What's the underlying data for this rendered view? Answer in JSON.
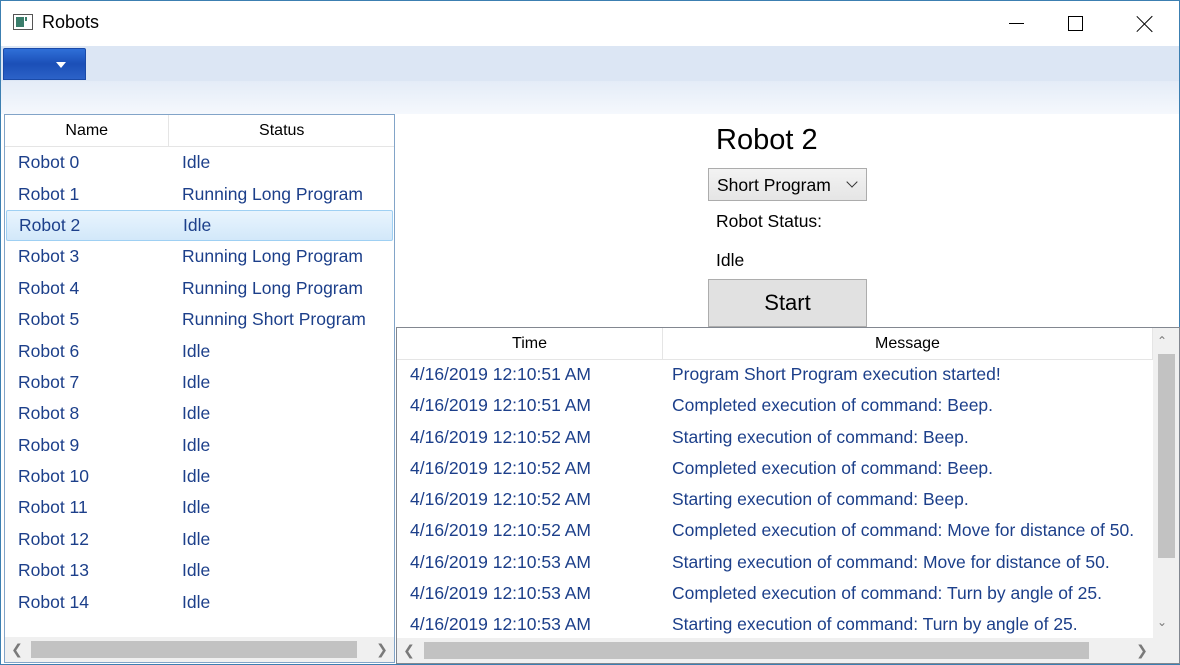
{
  "window": {
    "title": "Robots"
  },
  "titlebar": {
    "icon": "app-window-icon",
    "minimize_icon": "minimize-icon",
    "maximize_icon": "maximize-icon",
    "close_icon": "close-icon"
  },
  "menubar": {
    "app_menu_icon": "chevron-down-icon",
    "accent": "#2f6fd8",
    "background": "#dce6f4"
  },
  "robot_list": {
    "columns": [
      "Name",
      "Status"
    ],
    "selected_index": 2,
    "rows": [
      {
        "name": "Robot 0",
        "status": "Idle"
      },
      {
        "name": "Robot 1",
        "status": "Running Long Program"
      },
      {
        "name": "Robot 2",
        "status": "Idle"
      },
      {
        "name": "Robot 3",
        "status": "Running Long Program"
      },
      {
        "name": "Robot 4",
        "status": "Running Long Program"
      },
      {
        "name": "Robot 5",
        "status": "Running Short Program"
      },
      {
        "name": "Robot 6",
        "status": "Idle"
      },
      {
        "name": "Robot 7",
        "status": "Idle"
      },
      {
        "name": "Robot 8",
        "status": "Idle"
      },
      {
        "name": "Robot 9",
        "status": "Idle"
      },
      {
        "name": "Robot 10",
        "status": "Idle"
      },
      {
        "name": "Robot 11",
        "status": "Idle"
      },
      {
        "name": "Robot 12",
        "status": "Idle"
      },
      {
        "name": "Robot 13",
        "status": "Idle"
      },
      {
        "name": "Robot 14",
        "status": "Idle"
      }
    ]
  },
  "detail": {
    "title": "Robot 2",
    "program_select": {
      "value": "Short Program"
    },
    "status_label": "Robot Status:",
    "status_value": "Idle",
    "start_label": "Start"
  },
  "log": {
    "columns": [
      "Time",
      "Message"
    ],
    "rows": [
      {
        "time": "4/16/2019 12:10:51 AM",
        "message": "Program Short Program execution started!"
      },
      {
        "time": "4/16/2019 12:10:51 AM",
        "message": "Completed execution of command: Beep."
      },
      {
        "time": "4/16/2019 12:10:52 AM",
        "message": "Starting execution of command: Beep."
      },
      {
        "time": "4/16/2019 12:10:52 AM",
        "message": "Completed execution of command: Beep."
      },
      {
        "time": "4/16/2019 12:10:52 AM",
        "message": "Starting execution of command: Beep."
      },
      {
        "time": "4/16/2019 12:10:52 AM",
        "message": "Completed execution of command: Move for distance of 50."
      },
      {
        "time": "4/16/2019 12:10:53 AM",
        "message": "Starting execution of command: Move for distance of 50."
      },
      {
        "time": "4/16/2019 12:10:53 AM",
        "message": "Completed execution of command: Turn by angle of 25."
      },
      {
        "time": "4/16/2019 12:10:53 AM",
        "message": "Starting execution of command: Turn by angle of 25."
      }
    ]
  }
}
